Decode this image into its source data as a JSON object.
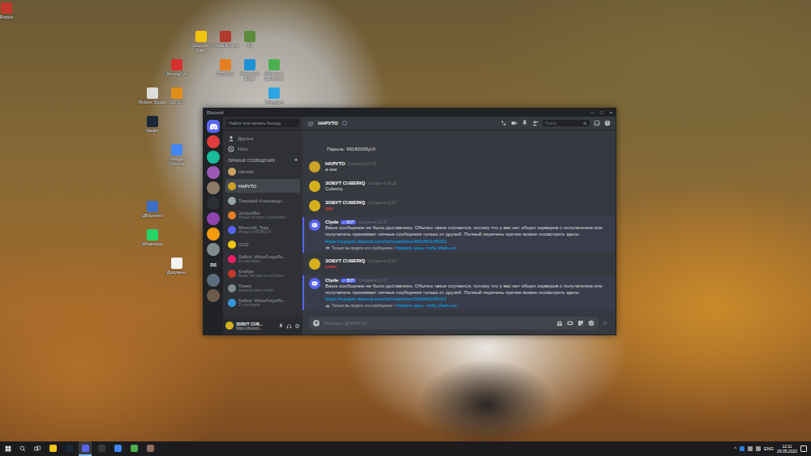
{
  "desktop": {
    "icons": [
      {
        "label": "Roblox",
        "color": "#c0392b"
      },
      {
        "label": "Geometry Dash",
        "color": "#f1c40f"
      },
      {
        "label": "Cheat Engine",
        "color": "#b03a2e"
      },
      {
        "label": "TL",
        "color": "#5d8c3a"
      },
      {
        "label": "Among Us",
        "color": "#d63031"
      },
      {
        "label": "GTA SA",
        "color": "#e67e22"
      },
      {
        "label": "Microsoft Edge",
        "color": "#1e90d6"
      },
      {
        "label": "Minecraft Launcher",
        "color": "#4caf50"
      },
      {
        "label": "Roblox Studio",
        "color": "#dcdcdc"
      },
      {
        "label": "CS GO",
        "color": "#e08e1b"
      },
      {
        "label": "Telegram",
        "color": "#2ca5e0"
      },
      {
        "label": "Steam",
        "color": "#1b2838"
      },
      {
        "label": "Google Chrome",
        "color": "#4285f4"
      },
      {
        "label": "qBittorrent",
        "color": "#3c6fc4"
      },
      {
        "label": "WhatsApp",
        "color": "#25d366"
      },
      {
        "label": "Документ",
        "color": "#f4f4f4"
      }
    ]
  },
  "discord": {
    "title": "Discord",
    "controls": [
      "–",
      "□",
      "×"
    ],
    "servers": [
      {
        "kind": "home",
        "label": "",
        "color": "#5865f2",
        "selected": true
      },
      {
        "kind": "server",
        "label": "",
        "color": "#e03c3c",
        "selected": false
      },
      {
        "kind": "server",
        "label": "",
        "color": "#1abc9c",
        "selected": false
      },
      {
        "kind": "server",
        "label": "",
        "color": "#9b59b6",
        "selected": false
      },
      {
        "kind": "server",
        "label": "",
        "color": "#8d7b68",
        "selected": false
      },
      {
        "kind": "server",
        "label": "",
        "color": "#2c2f33",
        "selected": false
      },
      {
        "kind": "server",
        "label": "",
        "color": "#8e44ad",
        "selected": false
      },
      {
        "kind": "server",
        "label": "",
        "color": "#f39c12",
        "selected": false
      },
      {
        "kind": "server",
        "label": "",
        "color": "#7f8c8d",
        "selected": false
      },
      {
        "kind": "server",
        "label": "DS",
        "color": "#23272a",
        "selected": false
      },
      {
        "kind": "server",
        "label": "",
        "color": "#5d6d7e",
        "selected": false
      },
      {
        "kind": "server",
        "label": "",
        "color": "#6c5b4b",
        "selected": false
      }
    ],
    "dm": {
      "search": "Найти или начать беседу",
      "nav": [
        "Друзья",
        "Nitro"
      ],
      "header": "ЛИЧНЫЕ СООБЩЕНИЯ",
      "add": "+",
      "items": [
        {
          "name": "Idantikk",
          "sub": "",
          "selected": false,
          "color": "#c8a165"
        },
        {
          "name": "НАРУТО",
          "sub": "",
          "selected": true,
          "color": "#c9a227"
        },
        {
          "name": "Тимофей Александр...",
          "sub": "",
          "selected": false,
          "color": "#95a5a6"
        },
        {
          "name": "JuniperBot",
          "sub": "Играет в https://JuniperBot",
          "selected": false,
          "color": "#e67e22"
        },
        {
          "name": "Minecraft_Tops",
          "sub": "Играет в ROBLOX",
          "selected": false,
          "color": "#5865f2"
        },
        {
          "name": "GOD",
          "sub": "",
          "selected": false,
          "color": "#f1c40f"
        },
        {
          "name": "Sallkid, WhiteForgeRe...",
          "sub": "3 участника",
          "selected": false,
          "color": "#e91e63"
        },
        {
          "name": "Клайди",
          "sub": "Всем чей мне в это было",
          "selected": false,
          "color": "#c0392b"
        },
        {
          "name": "Тимер",
          "sub": "написал мне слово",
          "selected": false,
          "color": "#7f8c8d"
        },
        {
          "name": "Sallkid, WhiteForgeRe...",
          "sub": "3 участника",
          "selected": false,
          "color": "#3498db"
        }
      ]
    },
    "user": {
      "name": "ЗОВУТ CUB...",
      "status": "https://discord...",
      "color": "#d4b01e"
    },
    "chat": {
      "at": "@",
      "channel": "НАРУТО",
      "search": "Поиск",
      "messages": [
        {
          "kind": "continued",
          "author": "",
          "time": "",
          "text": "Пароль: 99180395yUI",
          "failed": false,
          "color": "#c9a227",
          "badge": "",
          "link": "",
          "note": "",
          "action": ""
        },
        {
          "kind": "message",
          "author": "НАРУТО",
          "time": "Сегодня в 10:33",
          "text": "а ник",
          "failed": false,
          "color": "#c9a227",
          "badge": "",
          "link": "",
          "note": "",
          "action": ""
        },
        {
          "kind": "message",
          "author": "ЗОВУТ CUBERIQ",
          "time": "Сегодня в 10:33",
          "text": "Cuberiq",
          "failed": false,
          "color": "#d4b01e",
          "badge": "",
          "link": "",
          "note": "",
          "action": ""
        },
        {
          "kind": "message",
          "author": "ЗОВУТ CUBERIQ",
          "time": "Сегодня в 12:07",
          "text": "ррр",
          "failed": true,
          "color": "#d4b01e",
          "badge": "",
          "link": "",
          "note": "",
          "action": ""
        },
        {
          "kind": "system",
          "author": "Clyde",
          "time": "Сегодня в 12:07",
          "text": "Ваше сообщение не было доставлено. Обычно такое случается, потому что у вас нет общих серверов с получателем или получатель принимает личные сообщения только от друзей. Полный перечень причин можно посмотреть здесь:",
          "failed": false,
          "color": "#5865f2",
          "badge": "✓ BOT",
          "link": "https://support.discord.com/hc/ru/articles/360060145013",
          "note": "Только вы видите это сообщение •",
          "action": "Нажмите здесь, чтобы убрать его"
        },
        {
          "kind": "message",
          "author": "ЗОВУТ CUBERIQ",
          "time": "Сегодня в 12:07",
          "text": "клвгк",
          "failed": true,
          "color": "#d4b01e",
          "badge": "",
          "link": "",
          "note": "",
          "action": ""
        },
        {
          "kind": "system",
          "author": "Clyde",
          "time": "Сегодня в 12:07",
          "text": "Ваше сообщение не было доставлено. Обычно такое случается, потому что у вас нет общих серверов с получателем или получатель принимает личные сообщения только от друзей. Полный перечень причин можно посмотреть здесь:",
          "failed": false,
          "color": "#5865f2",
          "badge": "✓ BOT",
          "link": "https://support.discord.com/hc/ru/articles/360060145013",
          "note": "Только вы видите это сообщение •",
          "action": "Нажмите здесь, чтобы убрать его"
        }
      ],
      "composer": {
        "add": "+",
        "placeholder": "Написать @НАРУТО"
      }
    }
  },
  "taskbar": {
    "apps": [
      {
        "color": "#f0c419",
        "selected": false
      },
      {
        "color": "#1b2838",
        "selected": false
      },
      {
        "color": "#5865f2",
        "selected": true
      },
      {
        "color": "#3a3a3a",
        "selected": false
      },
      {
        "color": "#4285f4",
        "selected": false
      },
      {
        "color": "#4caf50",
        "selected": false
      },
      {
        "color": "#8d6e63",
        "selected": false
      }
    ],
    "tray": "^",
    "lang": "ENG",
    "time": "12:11",
    "date": "29.05.2022"
  }
}
